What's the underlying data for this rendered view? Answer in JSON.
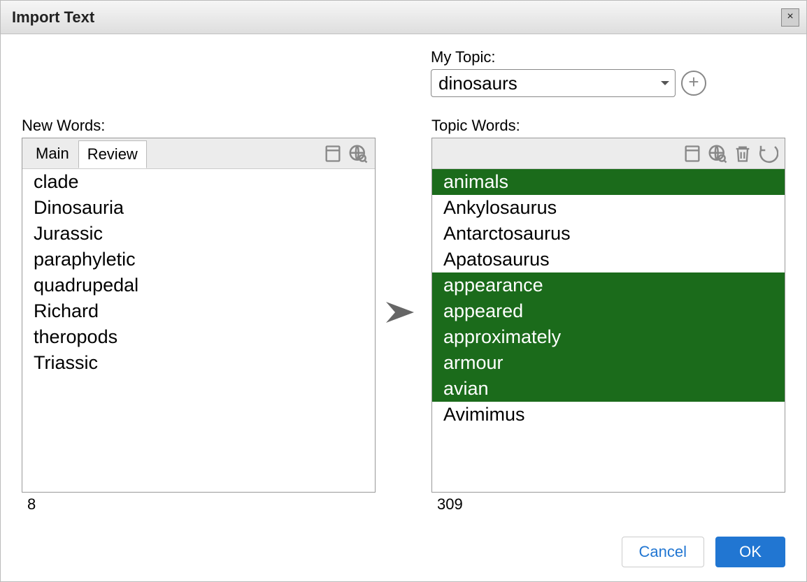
{
  "dialog": {
    "title": "Import Text"
  },
  "topic": {
    "label": "My Topic:",
    "selected": "dinosaurs"
  },
  "newWords": {
    "label": "New Words:",
    "tabs": {
      "main": "Main",
      "review": "Review"
    },
    "items": [
      {
        "text": "clade",
        "selected": false
      },
      {
        "text": "Dinosauria",
        "selected": false
      },
      {
        "text": "Jurassic",
        "selected": false
      },
      {
        "text": "paraphyletic",
        "selected": false
      },
      {
        "text": "quadrupedal",
        "selected": false
      },
      {
        "text": "Richard",
        "selected": false
      },
      {
        "text": "theropods",
        "selected": false
      },
      {
        "text": "Triassic",
        "selected": false
      }
    ],
    "count": "8"
  },
  "topicWords": {
    "label": "Topic Words:",
    "items": [
      {
        "text": "animals",
        "selected": true
      },
      {
        "text": "Ankylosaurus",
        "selected": false
      },
      {
        "text": "Antarctosaurus",
        "selected": false
      },
      {
        "text": "Apatosaurus",
        "selected": false
      },
      {
        "text": "appearance",
        "selected": true
      },
      {
        "text": "appeared",
        "selected": true
      },
      {
        "text": "approximately",
        "selected": true
      },
      {
        "text": "armour",
        "selected": true
      },
      {
        "text": "avian",
        "selected": true
      },
      {
        "text": "Avimimus",
        "selected": false
      }
    ],
    "count": "309"
  },
  "buttons": {
    "cancel": "Cancel",
    "ok": "OK"
  }
}
